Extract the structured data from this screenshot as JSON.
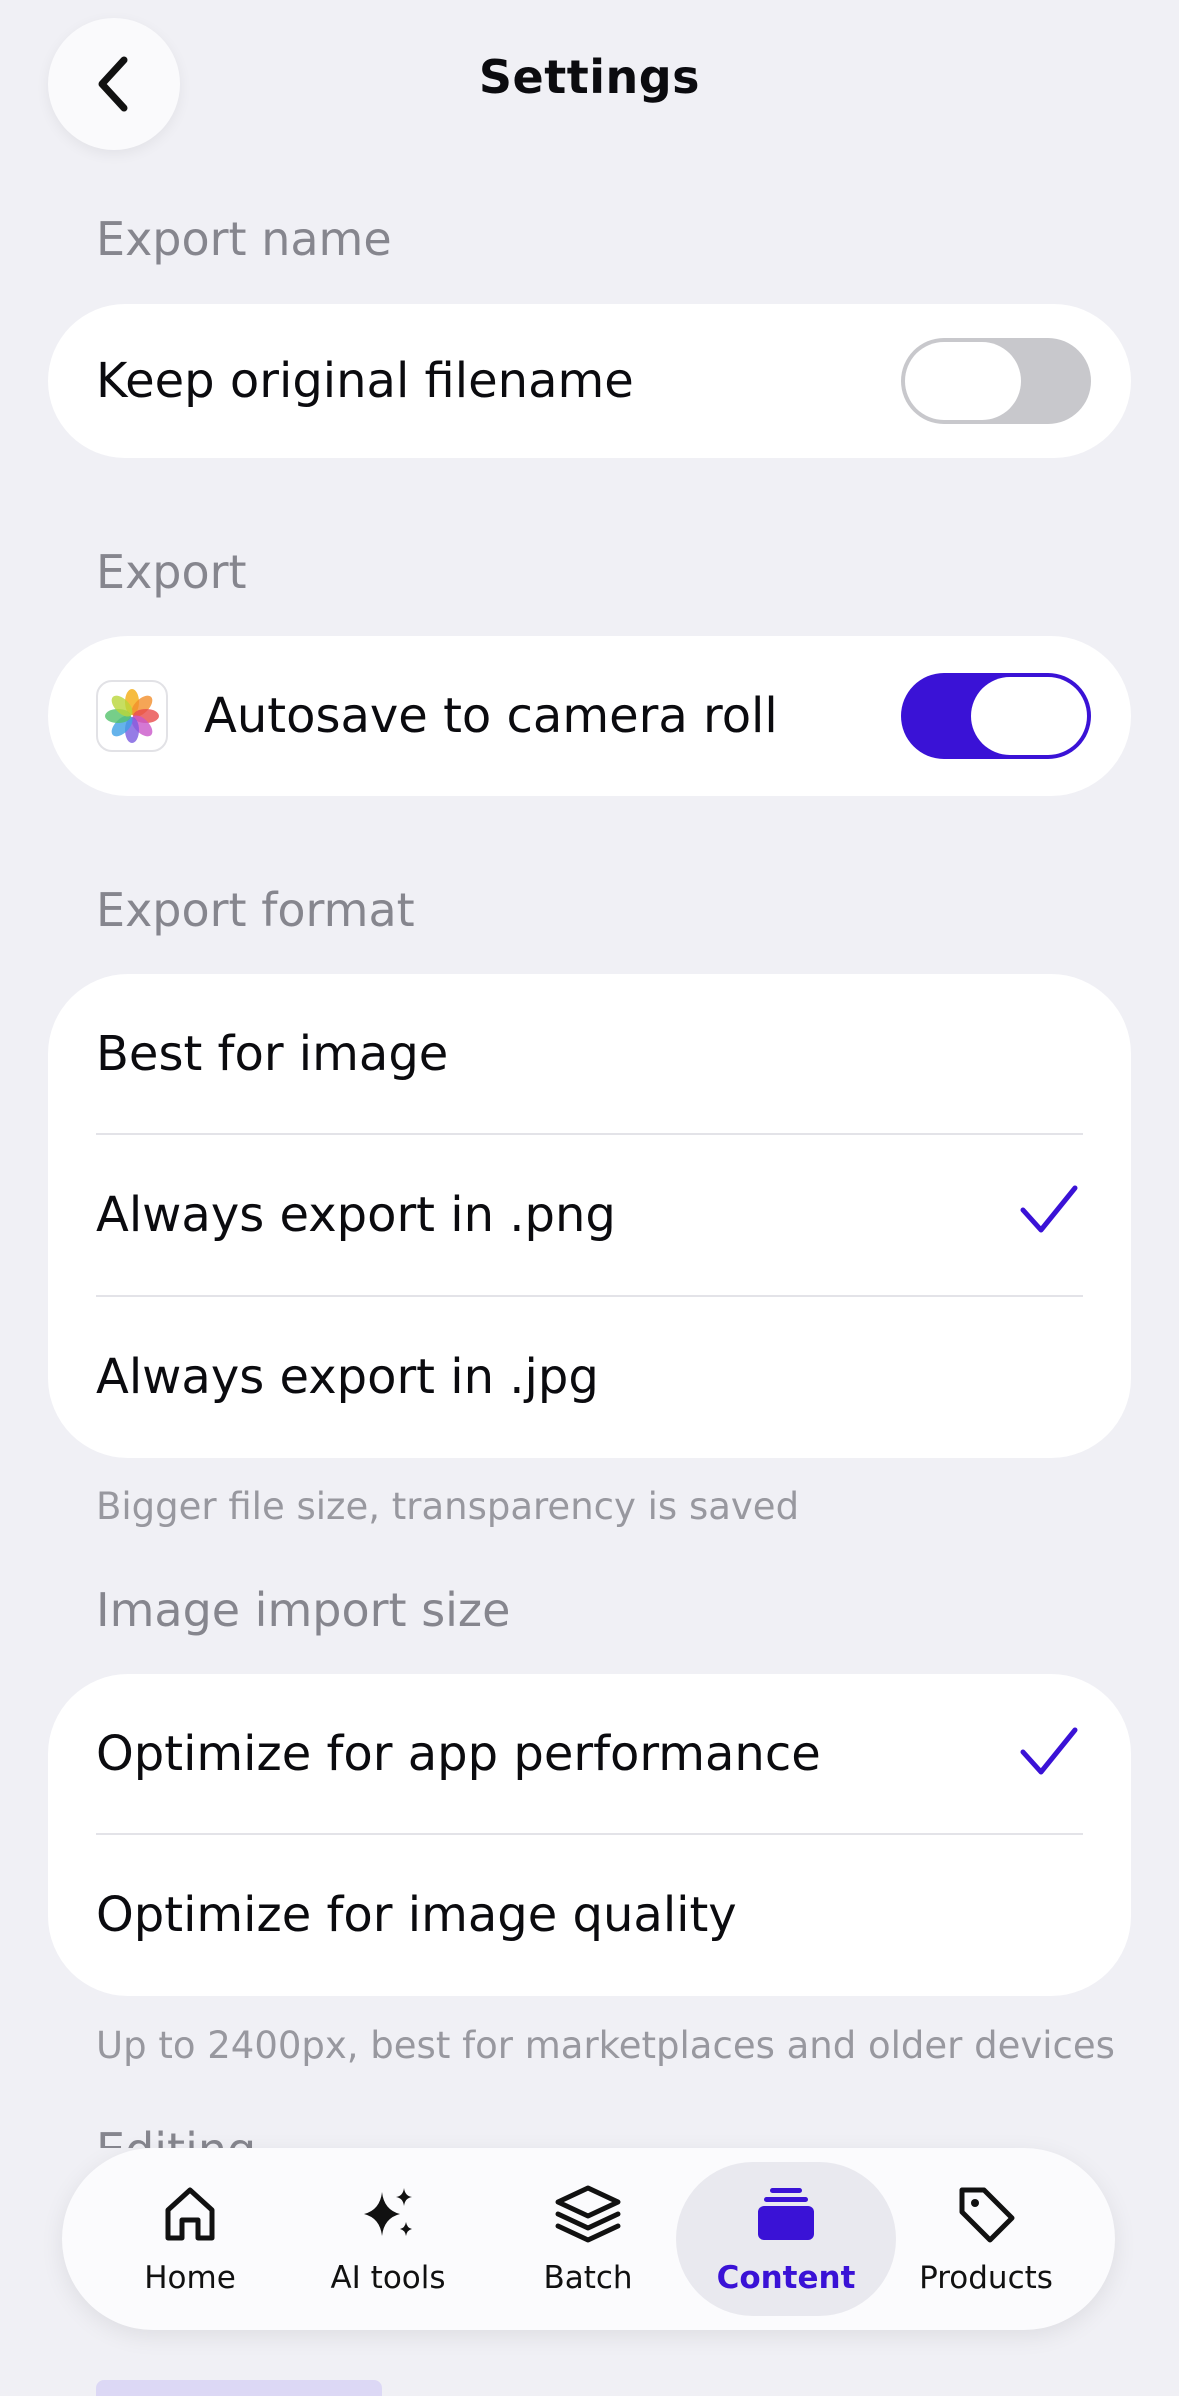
{
  "header": {
    "title": "Settings",
    "back_icon": "chevron-left-icon"
  },
  "export_name": {
    "label": "Export name",
    "keep_filename": {
      "label": "Keep original filename",
      "enabled": false
    }
  },
  "export": {
    "label": "Export",
    "autosave": {
      "label": "Autosave to camera roll",
      "enabled": true,
      "icon": "photos-icon"
    }
  },
  "export_format": {
    "label": "Export format",
    "options": [
      {
        "label": "Best for image",
        "selected": false
      },
      {
        "label": "Always export in .png",
        "selected": true
      },
      {
        "label": "Always export in .jpg",
        "selected": false
      }
    ],
    "helper": "Bigger file size, transparency is saved"
  },
  "import_size": {
    "label": "Image import size",
    "options": [
      {
        "label": "Optimize for app performance",
        "selected": true
      },
      {
        "label": "Optimize for image quality",
        "selected": false
      }
    ],
    "helper": "Up to 2400px, best for marketplaces and older devices"
  },
  "next_section": {
    "label": "Editing"
  },
  "tabbar": {
    "items": [
      {
        "label": "Home",
        "icon": "home-icon"
      },
      {
        "label": "AI tools",
        "icon": "sparkles-icon"
      },
      {
        "label": "Batch",
        "icon": "layers-icon"
      },
      {
        "label": "Content",
        "icon": "stack-icon",
        "active": true
      },
      {
        "label": "Products",
        "icon": "tag-icon"
      }
    ]
  },
  "colors": {
    "accent": "#3a12d6",
    "background": "#f0f0f5",
    "card": "#ffffff",
    "muted_text": "#86868e"
  }
}
